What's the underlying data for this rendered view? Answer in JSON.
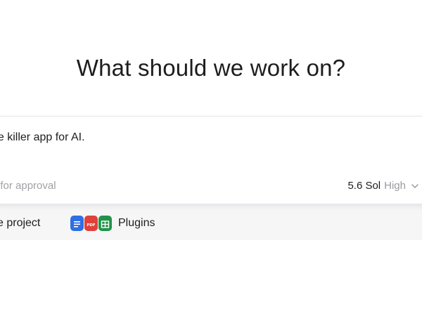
{
  "page": {
    "heading": "What should we work on?"
  },
  "composer": {
    "prompt_text": "he killer app for AI.",
    "approval_text": "t for approval",
    "model_name": "5.6 Sol",
    "effort_level": "High"
  },
  "bottom_bar": {
    "project_text": "e project",
    "plugins_label": "Plugins",
    "plugin_icons": [
      "docs-icon",
      "pdf-icon",
      "sheets-icon"
    ]
  },
  "colors": {
    "docs": "#2f6fe4",
    "pdf": "#e0413a",
    "sheets": "#23924a"
  }
}
